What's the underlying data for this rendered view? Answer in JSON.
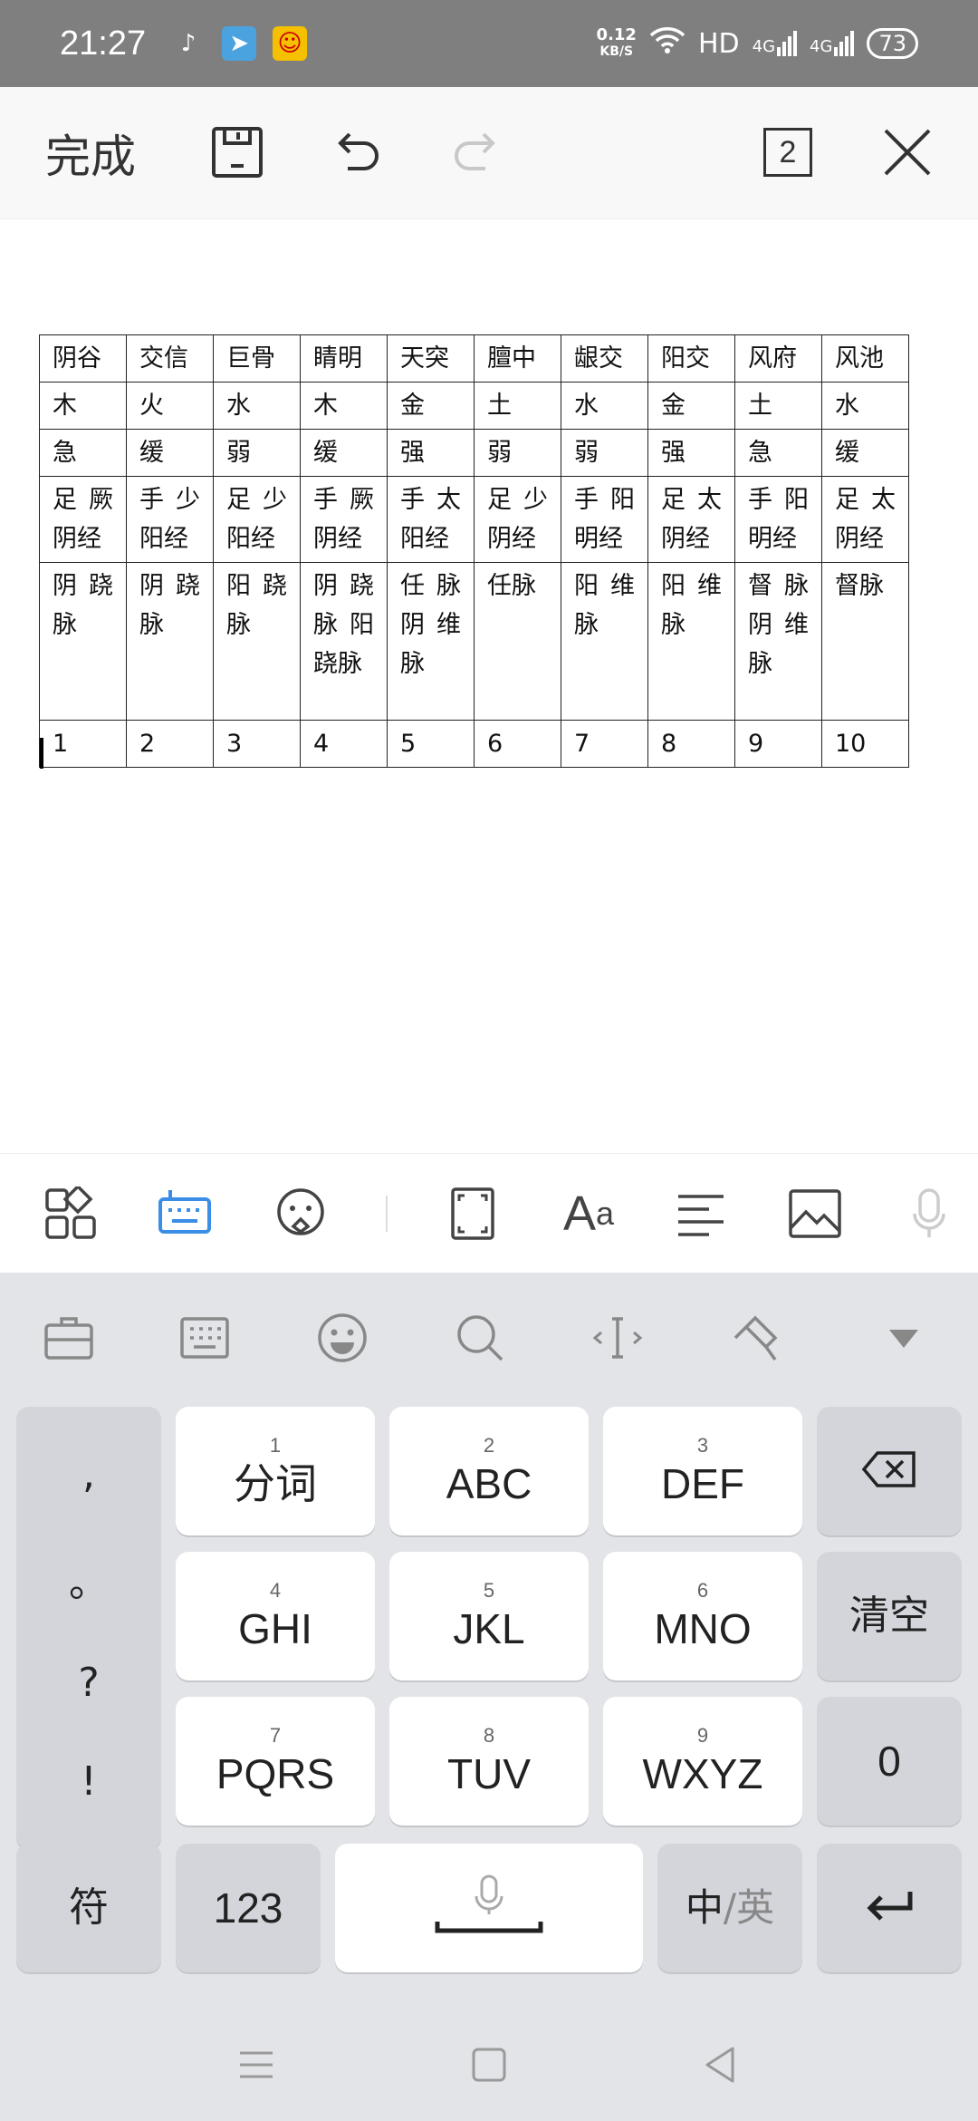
{
  "status_bar": {
    "time": "21:27",
    "speed_value": "0.12",
    "speed_unit": "KB/S",
    "network_hd": "HD",
    "network_1": "4G",
    "network_2": "4G",
    "battery": "73"
  },
  "toolbar": {
    "done_label": "完成",
    "page_count": "2"
  },
  "document": {
    "table": [
      [
        "阴谷",
        "交信",
        "巨骨",
        "睛明",
        "天突",
        "膻中",
        "龈交",
        "阳交",
        "风府",
        "风池"
      ],
      [
        "木",
        "火",
        "水",
        "木",
        "金",
        "土",
        "水",
        "金",
        "土",
        "水"
      ],
      [
        "急",
        "缓",
        "弱",
        "缓",
        "强",
        "弱",
        "弱",
        "强",
        "急",
        "缓"
      ],
      [
        "足厥阴经",
        "手少阳经",
        "足少阳经",
        "手厥阴经",
        "手太阳经",
        "足少阴经",
        "手阳明经",
        "足太阴经",
        "手阳明经",
        "足太阴经"
      ],
      [
        "阴跷脉",
        "阴跷脉",
        "阳跷脉",
        "阴跷脉阳跷脉",
        "任脉阴维脉",
        "任脉",
        "阳维脉",
        "阳维脉",
        "督脉阴维脉",
        "督脉"
      ],
      [
        "1",
        "2",
        "3",
        "4",
        "5",
        "6",
        "7",
        "8",
        "9",
        "10"
      ]
    ]
  },
  "keyboard": {
    "punctuation": [
      ",",
      "。",
      "?",
      "!"
    ],
    "keys_row1": [
      {
        "num": "1",
        "label": "分词"
      },
      {
        "num": "2",
        "label": "ABC"
      },
      {
        "num": "3",
        "label": "DEF"
      }
    ],
    "clear_label": "清空",
    "keys_row2": [
      {
        "num": "4",
        "label": "GHI"
      },
      {
        "num": "5",
        "label": "JKL"
      },
      {
        "num": "6",
        "label": "MNO"
      }
    ],
    "keys_row3": [
      {
        "num": "7",
        "label": "PQRS"
      },
      {
        "num": "8",
        "label": "TUV"
      },
      {
        "num": "9",
        "label": "WXYZ"
      }
    ],
    "zero_label": "0",
    "symbol_label": "符",
    "numeric_label": "123",
    "lang_label_cn": "中",
    "lang_label_sep": "/",
    "lang_label_en": "英"
  },
  "colors": {
    "accent": "#3a8ee6",
    "status_bar": "#7f7f7f",
    "keyboard_bg": "#e3e4e8"
  }
}
